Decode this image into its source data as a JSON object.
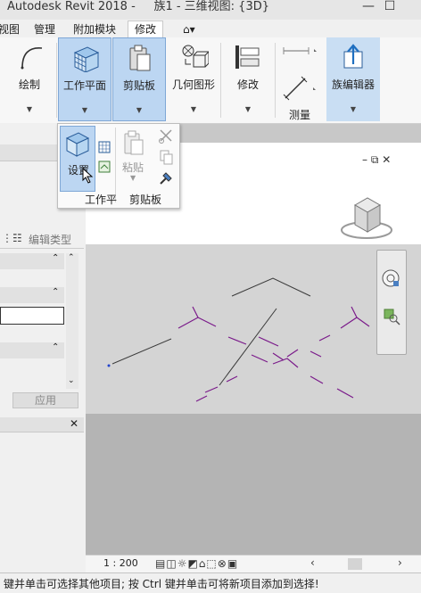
{
  "window": {
    "app_title": "Autodesk Revit 2018 -",
    "doc_title": "族1 - 三维视图: {3D}",
    "minimize_symbol": "—",
    "restore_symbol": "☐"
  },
  "ribbon_tabs": [
    "视图",
    "管理",
    "附加模块",
    "修改"
  ],
  "ribbon_tab_extra": "⌂▾",
  "ribbon": {
    "draw_label": "绘制",
    "work_plane_label": "工作平面",
    "clipboard_label": "剪贴板",
    "geometry_label": "几何图形",
    "modify_label": "修改",
    "measure_label": "测量",
    "family_editor_label": "族编辑器"
  },
  "dropdown": {
    "set_label": "设置",
    "work_plane_caption": "工作平",
    "paste_label": "粘贴",
    "clipboard_caption": "剪贴板"
  },
  "left_panel": {
    "edit_type_label": "编辑类型",
    "apply_label": "应用"
  },
  "view_controls": {
    "scale": "1 : 200"
  },
  "status_bar": {
    "message": "键并单击可选择其他项目; 按 Ctrl 键并单击可将新项目添加到选择!"
  },
  "colors": {
    "ribbon_highlight": "#bcd6f2",
    "model_line": "#3a3a3a",
    "reference_plane": "#7a1a8a"
  }
}
